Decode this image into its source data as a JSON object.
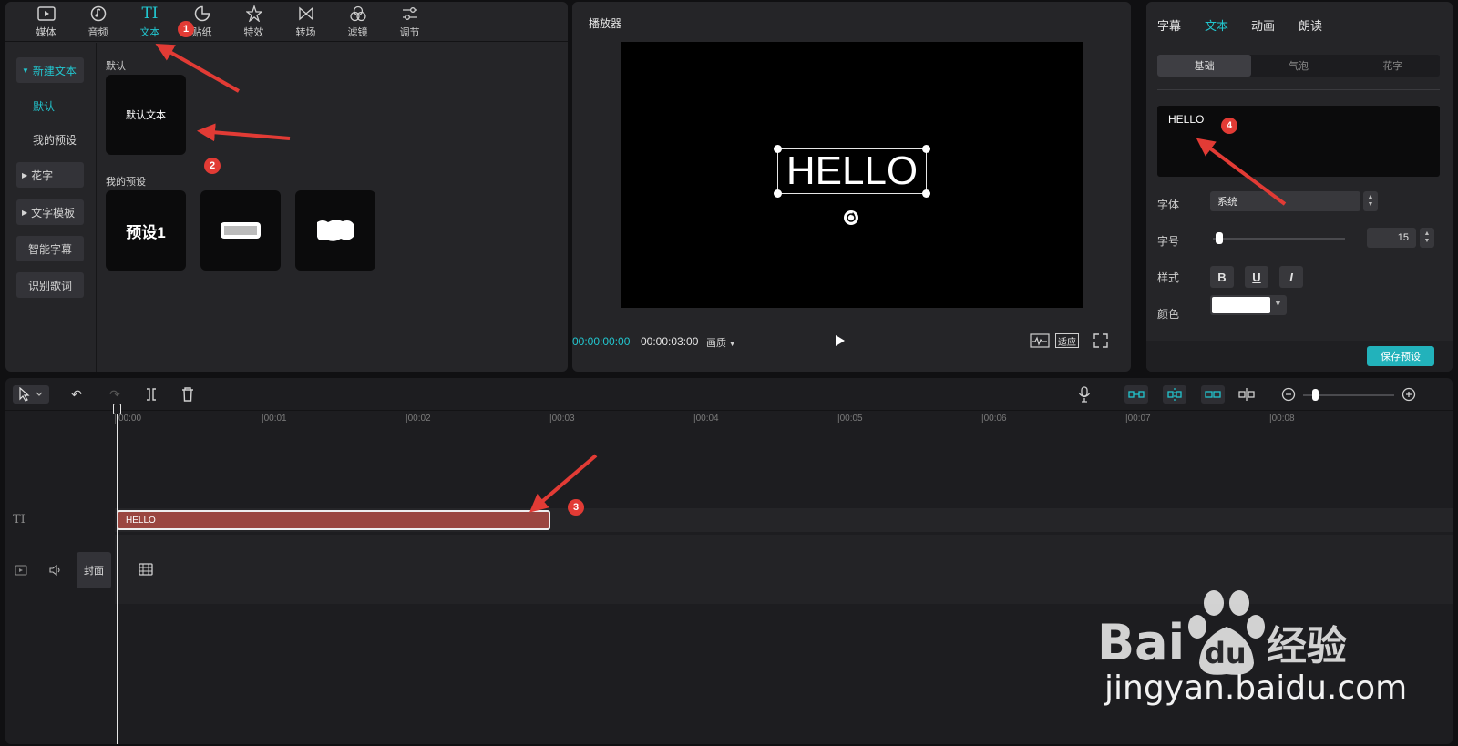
{
  "library": {
    "tools": [
      {
        "label": "媒体",
        "icon": "media-icon"
      },
      {
        "label": "音频",
        "icon": "audio-icon"
      },
      {
        "label": "文本",
        "icon": "text-icon",
        "active": true
      },
      {
        "label": "贴纸",
        "icon": "sticker-icon"
      },
      {
        "label": "特效",
        "icon": "effects-icon"
      },
      {
        "label": "转场",
        "icon": "transition-icon"
      },
      {
        "label": "滤镜",
        "icon": "filter-icon"
      },
      {
        "label": "调节",
        "icon": "adjust-icon"
      }
    ],
    "sidebar": {
      "new_text": "新建文本",
      "default": "默认",
      "my_presets": "我的预设",
      "fancy": "花字",
      "templates": "文字模板",
      "smart_captions": "智能字幕",
      "lyrics": "识别歌词"
    },
    "default_section": "默认",
    "default_card": "默认文本",
    "presets_section": "我的预设",
    "preset_card_1": "预设1"
  },
  "player": {
    "title": "播放器",
    "preview_text": "HELLO",
    "current_time": "00:00:00:00",
    "total_time": "00:00:03:00",
    "quality": "画质",
    "fit": "适应"
  },
  "inspector": {
    "tabs": [
      "字幕",
      "文本",
      "动画",
      "朗读"
    ],
    "active_tab": "文本",
    "subtabs": [
      "基础",
      "气泡",
      "花字"
    ],
    "text_value": "HELLO",
    "font_label": "字体",
    "font_value": "系统",
    "size_label": "字号",
    "size_value": "15",
    "size_fraction": 0.02,
    "style_label": "样式",
    "style_buttons": [
      "B",
      "U",
      "I"
    ],
    "color_label": "颜色",
    "color_value": "#ffffff",
    "save_preset": "保存预设"
  },
  "timeline": {
    "ticks": [
      "00:00",
      "|00:01",
      "|00:02",
      "|00:03",
      "|00:04",
      "|00:05",
      "|00:06",
      "|00:07",
      "|00:08"
    ],
    "text_clip": "HELLO",
    "cover": "封面"
  },
  "annotations": [
    "1",
    "2",
    "3",
    "4"
  ],
  "colors": {
    "accent": "#22c6cf",
    "clip": "#9a4640",
    "annotation": "#e23b35"
  },
  "watermark": {
    "brand": "Bai du 经验",
    "url": "jingyan.baidu.com"
  }
}
